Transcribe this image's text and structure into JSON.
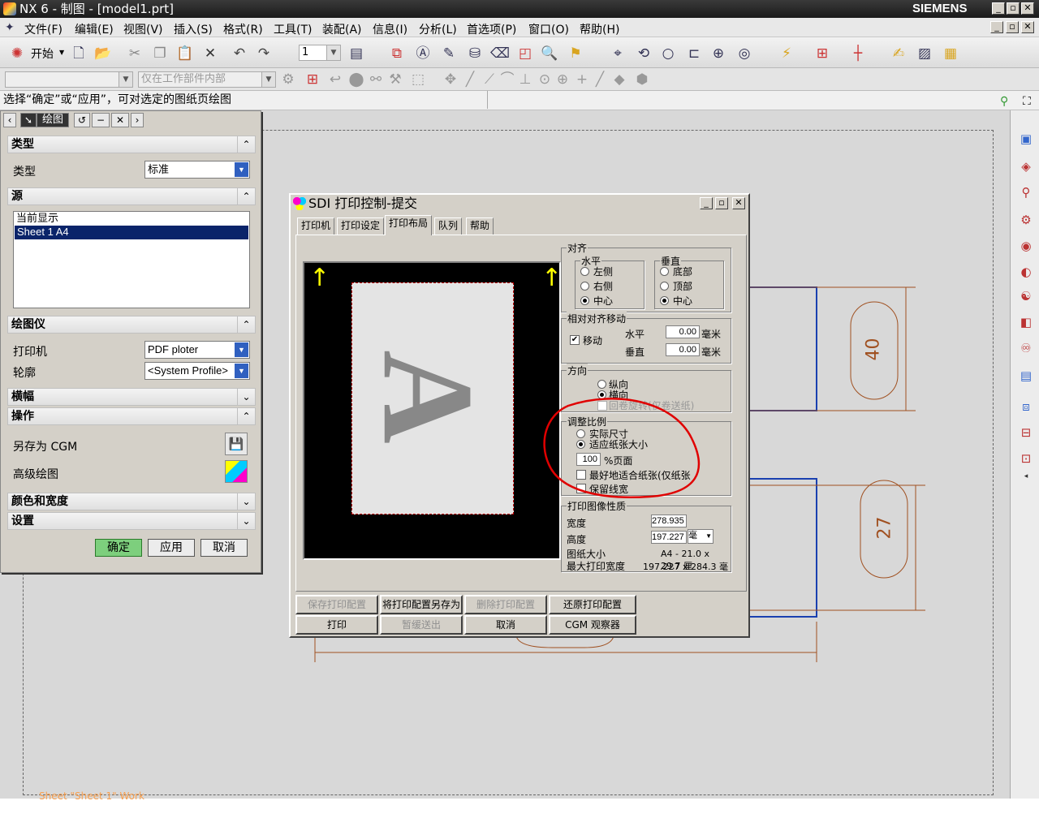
{
  "window": {
    "title": "NX 6 - 制图 - [model1.prt]",
    "brand": "SIEMENS"
  },
  "menubar": [
    "文件(F)",
    "编辑(E)",
    "视图(V)",
    "插入(S)",
    "格式(R)",
    "工具(T)",
    "装配(A)",
    "信息(I)",
    "分析(L)",
    "首选项(P)",
    "窗口(O)",
    "帮助(H)"
  ],
  "toolbar": {
    "start_label": "开始",
    "layer_value": "1"
  },
  "toolbar2": {
    "filter_combo": "",
    "scope_combo": "仅在工作部件内部"
  },
  "statusbar": {
    "prompt": "选择“确定”或“应用”，可对选定的图纸页绘图"
  },
  "panel": {
    "title": "绘图",
    "sections": {
      "type": "类型",
      "source": "源",
      "plotter": "绘图仪",
      "banner": "横幅",
      "operation": "操作",
      "color_width": "颜色和宽度",
      "settings": "设置"
    },
    "type_label": "类型",
    "type_value": "标准",
    "source_items": [
      "当前显示",
      "Sheet 1  A4"
    ],
    "printer_label": "打印机",
    "printer_value": "PDF ploter",
    "profile_label": "轮廓",
    "profile_value": "<System Profile>",
    "save_cgm_label": "另存为 CGM",
    "advanced_label": "高级绘图",
    "ok": "确定",
    "apply": "应用",
    "cancel": "取消"
  },
  "dialog": {
    "title": "SDI 打印控制-提交",
    "tabs": [
      "打印机",
      "打印设定",
      "打印布局",
      "队列",
      "帮助"
    ],
    "active_tab": "打印布局",
    "preview_letter": "A",
    "align": {
      "title": "对齐",
      "horizontal": {
        "title": "水平",
        "options": [
          "左侧",
          "右侧",
          "中心"
        ],
        "selected": "中心"
      },
      "vertical": {
        "title": "垂直",
        "options": [
          "底部",
          "顶部",
          "中心"
        ],
        "selected": "中心"
      }
    },
    "relative_move": {
      "title": "相对对齐移动",
      "move_label": "移动",
      "move_checked": true,
      "h_label": "水平",
      "h_value": "0.00",
      "v_label": "垂直",
      "v_value": "0.00",
      "unit": "毫米"
    },
    "orientation": {
      "title": "方向",
      "portrait": "纵向",
      "landscape": "横向",
      "selected": "横向",
      "rotate": "回卷旋转(仅卷送纸)"
    },
    "scale": {
      "title": "调整比例",
      "actual": "实际尺寸",
      "fit": "适应纸张大小",
      "selected": "适应纸张大小",
      "percent": "100",
      "percent_label": "%页面",
      "best_fit": "最好地适合纸张(仅纸张",
      "keep_line": "保留线宽"
    },
    "image": {
      "title": "打印图像性质",
      "width_label": "宽度",
      "width": "278.935",
      "height_label": "高度",
      "height": "197.227",
      "unit": "毫",
      "paper_label": "图纸大小",
      "paper": "A4 - 21.0 x 29.7 厘",
      "max_label": "最大打印宽度",
      "max": "197.227 x 284.3 毫"
    },
    "buttons": {
      "save": "保存打印配置",
      "save_as": "将打印配置另存为",
      "delete": "删除打印配置",
      "restore": "还原打印配置",
      "print": "打印",
      "pause": "暂缓送出",
      "cancel": "取消",
      "cgm": "CGM 观察器"
    }
  },
  "drawing": {
    "dim1": "40",
    "dim2": "27",
    "sheet_label": "Sheet \"Sheet 1\" Work"
  },
  "colors": {
    "annotation_red": "#e00000",
    "dimension": "#a05020",
    "selection": "#0a246a",
    "confirm": "#70c070"
  }
}
